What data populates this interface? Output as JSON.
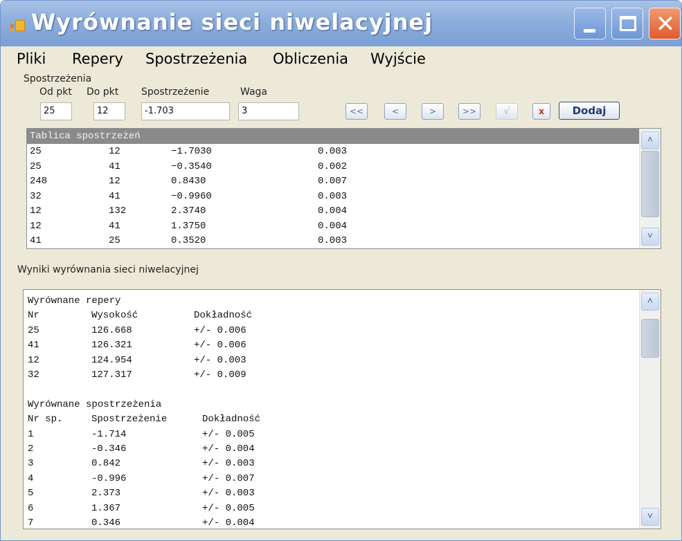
{
  "window": {
    "title": "Wyrównanie sieci niwelacyjnej",
    "close_glyph": "✕"
  },
  "menu": [
    "Pliki",
    "Repery",
    "Spostrzeżenia",
    "Obliczenia",
    "Wyjście"
  ],
  "observation_group": {
    "label": "Spostrzeżenia",
    "fields": [
      {
        "label": "Od pkt",
        "value": "25"
      },
      {
        "label": "Do pkt",
        "value": "12"
      },
      {
        "label": "Spostrzeżenie",
        "value": "-1.703"
      },
      {
        "label": "Waga",
        "value": "3"
      }
    ]
  },
  "nav_buttons": {
    "first": "<<",
    "prev": "<",
    "next": ">",
    "last": ">>",
    "accept": "√",
    "delete": "x",
    "add": "Dodaj"
  },
  "observations_table": {
    "header": "Tablica spostrzeżeń",
    "rows": [
      [
        "25",
        "12",
        "−1.7030",
        "0.003"
      ],
      [
        "25",
        "41",
        "−0.3540",
        "0.002"
      ],
      [
        "248",
        "12",
        "0.8430",
        "0.007"
      ],
      [
        "32",
        "41",
        "−0.9960",
        "0.003"
      ],
      [
        "12",
        "132",
        "2.3740",
        "0.004"
      ],
      [
        "12",
        "41",
        "1.3750",
        "0.004"
      ],
      [
        "41",
        "25",
        "0.3520",
        "0.003"
      ]
    ]
  },
  "results": {
    "label": "Wyniki wyrównania sieci niwelacyjnej",
    "benchmarks_title": "Wyrównane repery",
    "benchmarks_headers": [
      "Nr",
      "Wysokość",
      "Dokładność"
    ],
    "benchmarks": [
      [
        "25",
        "126.668",
        "+/- 0.006"
      ],
      [
        "41",
        "126.321",
        "+/- 0.006"
      ],
      [
        "12",
        "124.954",
        "+/- 0.003"
      ],
      [
        "32",
        "127.317",
        "+/- 0.009"
      ]
    ],
    "observations_title": "Wyrównane spostrzeżenia",
    "observations_headers": [
      "Nr sp.",
      "Spostrzeżenie",
      "Dokładność"
    ],
    "observations": [
      [
        "1",
        "-1.714",
        "+/- 0.005"
      ],
      [
        "2",
        "-0.346",
        "+/- 0.004"
      ],
      [
        "3",
        "0.842",
        "+/- 0.003"
      ],
      [
        "4",
        "-0.996",
        "+/- 0.007"
      ],
      [
        "5",
        "2.373",
        "+/- 0.003"
      ],
      [
        "6",
        "1.367",
        "+/- 0.005"
      ],
      [
        "7",
        "0.346",
        "+/- 0.004"
      ]
    ]
  }
}
